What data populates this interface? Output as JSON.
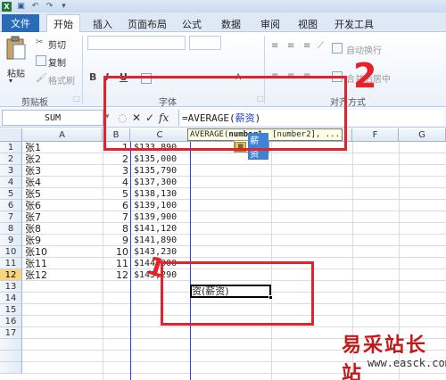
{
  "ribbon_tabs": [
    "文件",
    "开始",
    "插入",
    "页面布局",
    "公式",
    "数据",
    "审阅",
    "视图",
    "开发工具"
  ],
  "clipboard": {
    "paste": "粘贴",
    "cut": "剪切",
    "copy": "复制",
    "format_painter": "格式刷",
    "group": "剪贴板"
  },
  "font_group": {
    "label": "字体"
  },
  "align_group": {
    "wrap": "自动换行",
    "merge": "合并后居中",
    "label": "对齐方式"
  },
  "name_box": "SUM",
  "formula_bar": {
    "prefix": "=AVERAGE(",
    "arg": "薪资",
    "suffix": ")"
  },
  "tooltip": {
    "func": "AVERAGE(",
    "arg1": "number1",
    "rest": ", [number2], ...)"
  },
  "autocomplete": {
    "item": "薪资"
  },
  "columns": [
    "A",
    "B",
    "C",
    "D",
    "E",
    "F",
    "G"
  ],
  "rows": [
    "1",
    "2",
    "3",
    "4",
    "5",
    "6",
    "7",
    "8",
    "9",
    "10",
    "11",
    "12",
    "13",
    "14",
    "15",
    "16",
    "17"
  ],
  "names": [
    "张1",
    "张2",
    "张3",
    "张4",
    "张5",
    "张6",
    "张7",
    "张8",
    "张9",
    "张10",
    "张11",
    "张12"
  ],
  "nums": [
    "1",
    "2",
    "3",
    "4",
    "5",
    "6",
    "7",
    "8",
    "9",
    "10",
    "11",
    "12"
  ],
  "salaries": [
    "$133,890",
    "$135,000",
    "$135,790",
    "$137,300",
    "$138,130",
    "$139,100",
    "$139,900",
    "$141,120",
    "$141,890",
    "$143,230",
    "$144,000",
    "$145,290"
  ],
  "active_cell_text": "资(薪资)",
  "annotation": {
    "one": "1",
    "two": "2"
  },
  "watermark": {
    "title": "易采站长站",
    "url": "www.easck.com"
  },
  "colors": {
    "annotation_red": "#e8202a",
    "selection_blue": "#2b3cff"
  }
}
